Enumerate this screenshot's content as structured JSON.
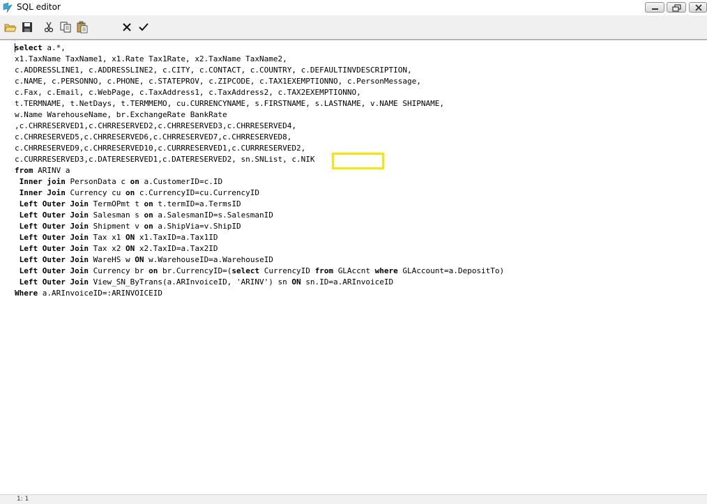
{
  "window": {
    "title": "SQL editor"
  },
  "toolbar": {
    "buttons": [
      {
        "name": "open-icon"
      },
      {
        "name": "save-icon"
      },
      {
        "name": "cut-icon"
      },
      {
        "name": "copy-icon"
      },
      {
        "name": "paste-icon"
      },
      {
        "name": "cancel-icon"
      },
      {
        "name": "apply-icon"
      }
    ]
  },
  "editor": {
    "lines": [
      "select a.*,",
      "x1.TaxName TaxName1, x1.Rate Tax1Rate, x2.TaxName TaxName2,",
      "c.ADDRESSLINE1, c.ADDRESSLINE2, c.CITY, c.CONTACT, c.COUNTRY, c.DEFAULTINVDESCRIPTION,",
      "c.NAME, c.PERSONNO, c.PHONE, c.STATEPROV, c.ZIPCODE, c.TAX1EXEMPTIONNO, c.PersonMessage,",
      "c.Fax, c.Email, c.WebPage, c.TaxAddress1, c.TaxAddress2, c.TAX2EXEMPTIONNO,",
      "t.TERMNAME, t.NetDays, t.TERMMEMO, cu.CURRENCYNAME, s.FIRSTNAME, s.LASTNAME, v.NAME SHIPNAME,",
      "w.Name WarehouseName, br.ExchangeRate BankRate",
      ",c.CHRRESERVED1,c.CHRRESERVED2,c.CHRRESERVED3,c.CHRRESERVED4,",
      "c.CHRRESERVED5,c.CHRRESERVED6,c.CHRRESERVED7,c.CHRRESERVED8,",
      "c.CHRRESERVED9,c.CHRRESERVED10,c.CURRRESERVED1,c.CURRRESERVED2,",
      "c.CURRRESERVED3,c.DATERESERVED1,c.DATERESERVED2, sn.SNList, c.NIK",
      "from ARINV a",
      " Inner join PersonData c on a.CustomerID=c.ID",
      " Inner Join Currency cu on c.CurrencyID=cu.CurrencyID",
      " Left Outer Join TermOPmt t on t.termID=a.TermsID",
      " Left Outer Join Salesman s on a.SalesmanID=s.SalesmanID",
      " Left Outer Join Shipment v on a.ShipVia=v.ShipID",
      " Left Outer Join Tax x1 ON x1.TaxID=a.Tax1ID",
      " Left Outer Join Tax x2 ON x2.TaxID=a.Tax2ID",
      " Left Outer Join WareHS w ON w.WarehouseID=a.WarehouseID",
      " Left Outer Join Currency br on br.CurrencyID=(select CurrencyID from GLAccnt where GLAccount=a.DepositTo)",
      " Left Outer Join View_SN_ByTrans(a.ARInvoiceID, 'ARINV') sn ON sn.ID=a.ARInvoiceID",
      "Where a.ARInvoiceID=:ARINVOICEID"
    ],
    "keywords": [
      "select",
      "from",
      "Inner",
      "join",
      "Join",
      "Left",
      "Outer",
      "on",
      "ON",
      "Where",
      "where"
    ]
  },
  "status": {
    "cursor_position": "1: 1"
  },
  "colors": {
    "highlight": "#f2e60a"
  }
}
